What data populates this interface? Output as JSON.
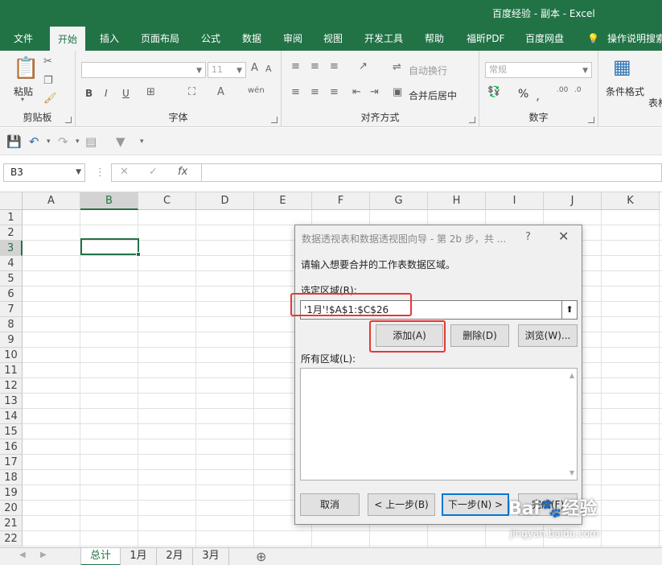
{
  "window": {
    "title": "百度经验 - 副本  -  Excel"
  },
  "tabs": [
    "文件",
    "开始",
    "插入",
    "页面布局",
    "公式",
    "数据",
    "审阅",
    "视图",
    "开发工具",
    "帮助",
    "福昕PDF",
    "百度网盘"
  ],
  "tell_me": "操作说明搜索",
  "ribbon": {
    "clipboard": {
      "label": "剪贴板",
      "paste": "粘贴"
    },
    "font": {
      "label": "字体",
      "size": "11",
      "bold": "B",
      "italic": "I",
      "underline": "U"
    },
    "alignment": {
      "label": "对齐方式",
      "wrap": "自动换行",
      "merge": "合并后居中"
    },
    "number": {
      "label": "数字",
      "format": "常规",
      "percent": "%"
    },
    "styles": {
      "conditional": "条件格式",
      "table": "表格"
    }
  },
  "formula_bar": {
    "name_box": "B3",
    "fx": "fx",
    "value": ""
  },
  "columns": [
    "A",
    "B",
    "C",
    "D",
    "E",
    "F",
    "G",
    "H",
    "I",
    "J",
    "K"
  ],
  "rows": [
    "1",
    "2",
    "3",
    "4",
    "5",
    "6",
    "7",
    "8",
    "9",
    "10",
    "11",
    "12",
    "13",
    "14",
    "15",
    "16",
    "17",
    "18",
    "19",
    "20",
    "21",
    "22"
  ],
  "selected_cell": {
    "col": "B",
    "row": "3"
  },
  "sheets": [
    "总计",
    "1月",
    "2月",
    "3月"
  ],
  "active_sheet": "总计",
  "dialog": {
    "title": "数据透视表和数据透视图向导 - 第 2b 步，共 ...",
    "help": "?",
    "close": "✕",
    "instruction": "请输入想要合并的工作表数据区域。",
    "range_label": "选定区域(R):",
    "range_value": "'1月'!$A$1:$C$26",
    "add_button": "添加(A)",
    "delete_button": "删除(D)",
    "browse_button": "浏览(W)...",
    "all_ranges_label": "所有区域(L):",
    "cancel_button": "取消",
    "back_button": "< 上一步(B)",
    "next_button": "下一步(N) >",
    "finish_button": "完成(F)"
  },
  "watermark": {
    "main": "Bai🐾经验",
    "sub": "jingyan.baidu.com"
  },
  "colors": {
    "excel_green": "#217346",
    "highlight_red": "#e53935"
  }
}
